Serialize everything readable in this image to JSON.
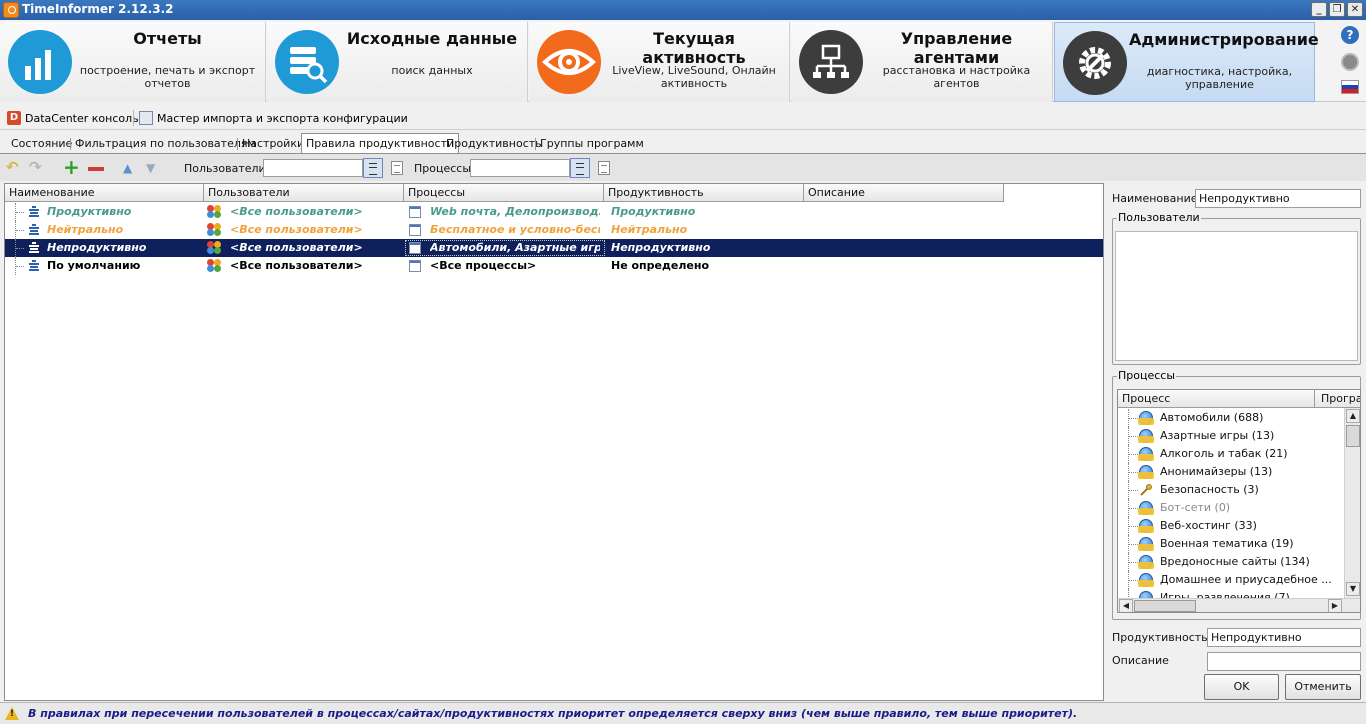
{
  "window": {
    "title": "TimeInformer 2.12.3.2",
    "minimize": "_",
    "restore": "❐",
    "close": "✕"
  },
  "nav": [
    {
      "title": "Отчеты",
      "subtitle": "построение, печать и экспорт отчетов",
      "icon": "bar-chart-icon",
      "color": "#1f9ad6"
    },
    {
      "title": "Исходные данные",
      "subtitle": "поиск данных",
      "icon": "database-search-icon",
      "color": "#1f9ad6"
    },
    {
      "title": "Текущая активность",
      "subtitle": "LiveView, LiveSound, Онлайн активность",
      "icon": "eye-icon",
      "color": "#f26a1b"
    },
    {
      "title": "Управление агентами",
      "subtitle": "расстановка и настройка агентов",
      "icon": "network-icon",
      "color": "#3d3d3d"
    },
    {
      "title": "Администрирование",
      "subtitle": "диагностика, настройка, управление",
      "icon": "gear-wrench-icon",
      "color": "#3d3d3d",
      "active": true
    }
  ],
  "toolbar1": {
    "datacenter": "DataCenter консоль",
    "wizard": "Мастер импорта и экспорта конфигурации"
  },
  "tabs": [
    "Состояние",
    "Фильтрация по пользователям",
    "Настройки",
    "Правила продуктивности",
    "Продуктивность",
    "Группы программ"
  ],
  "active_tab": "Правила продуктивности",
  "toolbar2": {
    "users_label": "Пользователи",
    "users_value": "",
    "processes_label": "Процессы",
    "processes_value": ""
  },
  "grid": {
    "columns": [
      "Наименование",
      "Пользователи",
      "Процессы",
      "Продуктивность",
      "Описание"
    ],
    "rows": [
      {
        "name": "Продуктивно",
        "users": "<Все пользователи>",
        "processes": "Web почта, Делопроизвод...",
        "productivity": "Продуктивно",
        "description": "",
        "color": "#4a9a8c"
      },
      {
        "name": "Нейтрально",
        "users": "<Все пользователи>",
        "processes": "Бесплатное и условно-бесп...",
        "productivity": "Нейтрально",
        "description": "",
        "color": "#f0a33a"
      },
      {
        "name": "Непродуктивно",
        "users": "<Все пользователи>",
        "processes": "Автомобили, Азартные игр...",
        "productivity": "Непродуктивно",
        "description": "",
        "color": "#ffffff"
      },
      {
        "name": "По умолчанию",
        "users": "<Все пользователи>",
        "processes": "<Все процессы>",
        "productivity": "Не определено",
        "description": "",
        "color": "#000000"
      }
    ],
    "selected_row": 2
  },
  "details": {
    "name_label": "Наименование",
    "name_value": "Непродуктивно",
    "users_group": "Пользователи",
    "processes_group": "Процессы",
    "proc_columns": [
      "Процесс",
      "Програ"
    ],
    "processes": [
      {
        "label": "Автомобили (688)",
        "icon": "globe-icon",
        "disabled": false
      },
      {
        "label": "Азартные игры (13)",
        "icon": "globe-icon",
        "disabled": false
      },
      {
        "label": "Алкоголь и табак (21)",
        "icon": "globe-icon",
        "disabled": false
      },
      {
        "label": "Анонимайзеры (13)",
        "icon": "globe-icon",
        "disabled": false
      },
      {
        "label": "Безопасность (3)",
        "icon": "key-icon",
        "disabled": false
      },
      {
        "label": "Бот-сети (0)",
        "icon": "globe-icon",
        "disabled": true
      },
      {
        "label": "Веб-хостинг (33)",
        "icon": "globe-icon",
        "disabled": false
      },
      {
        "label": "Военная тематика (19)",
        "icon": "globe-icon",
        "disabled": false
      },
      {
        "label": "Вредоносные сайты (134)",
        "icon": "globe-icon",
        "disabled": false
      },
      {
        "label": "Домашнее и приусадебное ...",
        "icon": "globe-icon",
        "disabled": false
      },
      {
        "label": "Игры, развлечения (7)",
        "icon": "globe-icon",
        "disabled": false
      }
    ],
    "productivity_label": "Продуктивность",
    "productivity_value": "Непродуктивно",
    "description_label": "Описание",
    "description_value": "",
    "ok": "OK",
    "cancel": "Отменить"
  },
  "status": "В правилах при пересечении пользователей в процессах/сайтах/продуктивностях приоритет определяется сверху вниз (чем выше правило, тем выше приоритет)."
}
